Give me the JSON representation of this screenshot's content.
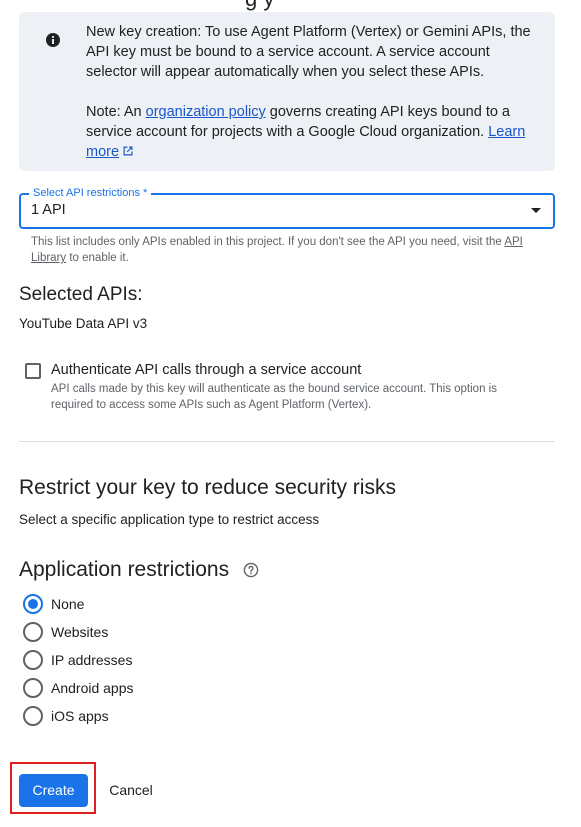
{
  "top_cut_text": "g  y",
  "info_box": {
    "icon": "info-icon",
    "para1": "New key creation: To use Agent Platform (Vertex) or Gemini APIs, the API key must be bound to a service account. A service account selector will appear automatically when you select these APIs.",
    "para2_prefix": "Note: An ",
    "para2_link": "organization policy",
    "para2_mid": " governs creating API keys bound to a service account for projects with a Google Cloud organization. ",
    "para2_learn_more": "Learn more"
  },
  "api_restrictions": {
    "label": "Select API restrictions *",
    "value": "1 API",
    "helper_text": "This list includes only APIs enabled in this project. If you don't see the API you need, visit the ",
    "helper_link": "API Library",
    "helper_suffix": " to enable it."
  },
  "selected_apis": {
    "heading": "Selected APIs:",
    "items": [
      "YouTube Data API v3"
    ]
  },
  "service_account_checkbox": {
    "label": "Authenticate API calls through a service account",
    "description": "API calls made by this key will authenticate as the bound service account. This option is required to access some APIs such as Agent Platform (Vertex).",
    "checked": false
  },
  "restrict_section": {
    "heading": "Restrict your key to reduce security risks",
    "subtitle": "Select a specific application type to restrict access"
  },
  "application_restrictions": {
    "heading": "Application restrictions",
    "options": [
      {
        "label": "None",
        "checked": true
      },
      {
        "label": "Websites",
        "checked": false
      },
      {
        "label": "IP addresses",
        "checked": false
      },
      {
        "label": "Android apps",
        "checked": false
      },
      {
        "label": "iOS apps",
        "checked": false
      }
    ]
  },
  "actions": {
    "create_label": "Create",
    "cancel_label": "Cancel"
  },
  "colors": {
    "primary": "#1a73e8",
    "link": "#1a56c9",
    "info_bg": "#edf0f5",
    "highlight": "#e02020"
  }
}
